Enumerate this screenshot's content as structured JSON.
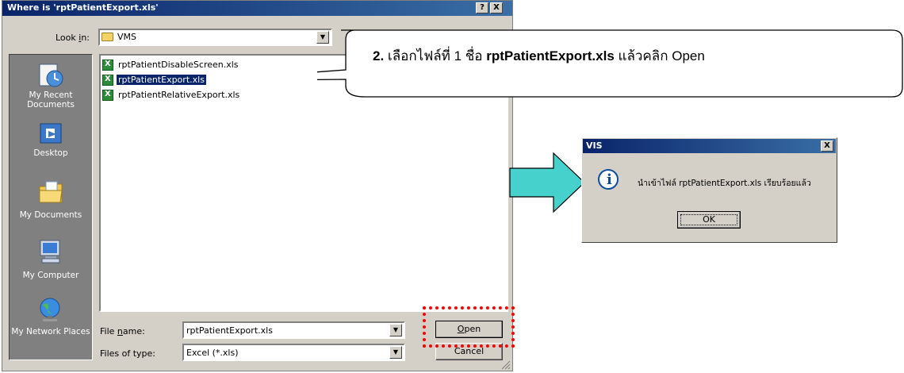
{
  "dialog": {
    "title": "Where is 'rptPatientExport.xls'",
    "help_btn": "?",
    "close_btn": "X",
    "lookin_label_pre": "Look ",
    "lookin_label_u": "i",
    "lookin_label_post": "n:",
    "lookin_value": "VMS",
    "places": [
      {
        "label": "My Recent Documents",
        "icon": "recent-documents-icon"
      },
      {
        "label": "Desktop",
        "icon": "desktop-icon"
      },
      {
        "label": "My Documents",
        "icon": "my-documents-icon"
      },
      {
        "label": "My Computer",
        "icon": "my-computer-icon"
      },
      {
        "label": "My Network Places",
        "icon": "network-places-icon"
      }
    ],
    "files": [
      {
        "name": "rptPatientDisableScreen.xls",
        "selected": false
      },
      {
        "name": "rptPatientExport.xls",
        "selected": true
      },
      {
        "name": "rptPatientRelativeExport.xls",
        "selected": false
      }
    ],
    "filename_label_pre": "File ",
    "filename_label_u": "n",
    "filename_label_post": "ame:",
    "filename_value": "rptPatientExport.xls",
    "filetype_label": "Files of type:",
    "filetype_value": "Excel (*.xls)",
    "open_btn_u": "O",
    "open_btn_rest": "pen",
    "cancel_btn": "Cancel"
  },
  "callout": {
    "step": "2.",
    "text_a": " เลือกไฟล์ที่ 1 ชื่อ ",
    "file": "rptPatientExport.xls",
    "text_b": " แล้วคลิก Open"
  },
  "message": {
    "title": "VIS",
    "close_btn": "X",
    "text": "นำเข้าไฟล์ rptPatientExport.xls เรียบร้อยแล้ว",
    "ok_btn": "OK"
  },
  "colors": {
    "highlight_dash": "#ff0000",
    "arrow_fill": "#47d1cc",
    "selection": "#0a246a"
  }
}
